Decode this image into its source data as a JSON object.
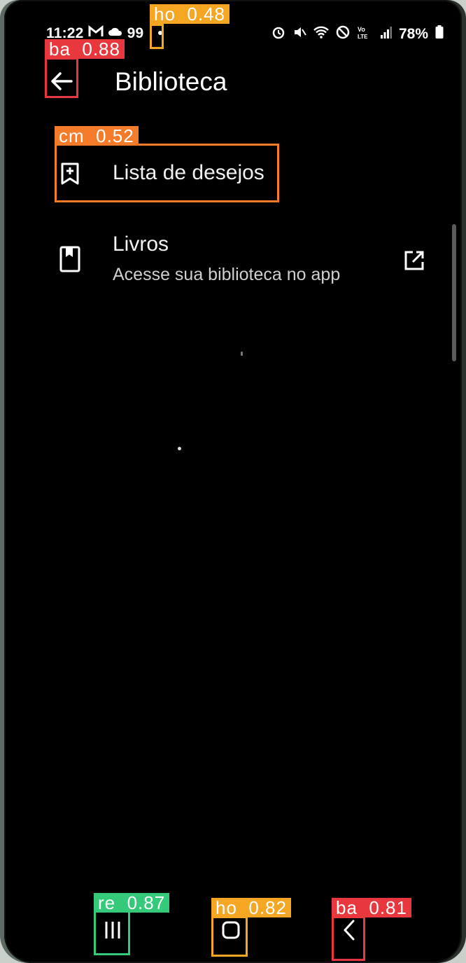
{
  "status_bar": {
    "time": "11:22",
    "notif_count": "99",
    "battery": "78%",
    "left_icons": [
      "gmail-icon",
      "cloud-icon"
    ],
    "right_icons": [
      "alarm-icon",
      "mute-icon",
      "wifi-icon",
      "dnd-icon",
      "volte-icon",
      "signal-icon",
      "battery-icon"
    ]
  },
  "app_bar": {
    "title": "Biblioteca"
  },
  "menu": {
    "items": [
      {
        "label": "Lista de desejos",
        "icon": "bookmark-add-icon"
      },
      {
        "label": "Livros",
        "sub": "Acesse sua biblioteca no app",
        "icon": "book-icon",
        "trailing_icon": "open-in-new-icon"
      }
    ]
  },
  "nav_bar": {
    "buttons": [
      "recents-icon",
      "home-icon",
      "back-icon"
    ]
  },
  "detections": [
    {
      "label": "ho  0.48",
      "color": "#f5a623"
    },
    {
      "label": "ba  0.88",
      "color": "#e8383d"
    },
    {
      "label": "cm  0.52",
      "color": "#f47b2a"
    },
    {
      "label": "re  0.87",
      "color": "#35c97a"
    },
    {
      "label": "ho  0.82",
      "color": "#f5a623"
    },
    {
      "label": "ba  0.81",
      "color": "#e8383d"
    }
  ]
}
